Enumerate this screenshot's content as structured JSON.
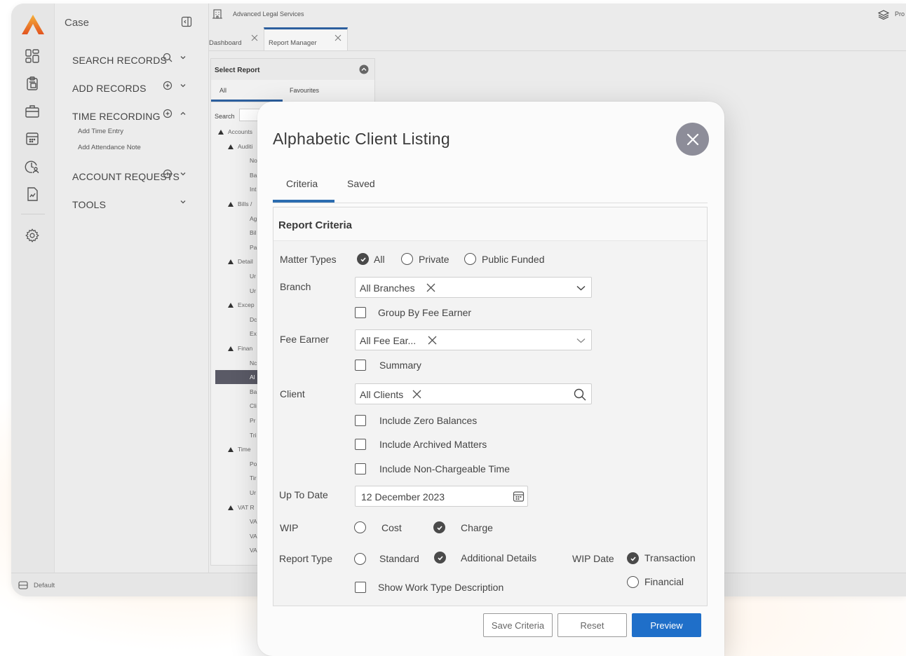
{
  "app": {
    "company": "Advanced Legal Services",
    "profile_label": "Pro",
    "status_label": "Default"
  },
  "sidebar": {
    "title": "Case",
    "items": [
      {
        "label": "SEARCH RECORDS",
        "icon": "search-icon"
      },
      {
        "label": "ADD RECORDS",
        "icon": "plus-circle-icon"
      },
      {
        "label": "TIME RECORDING",
        "icon": "plus-circle-icon"
      },
      {
        "label": "ACCOUNT REQUESTS",
        "icon": "plus-circle-icon"
      },
      {
        "label": "TOOLS",
        "icon": ""
      }
    ],
    "time_recording_sub": [
      "Add Time Entry",
      "Add Attendance Note"
    ]
  },
  "tabs": [
    {
      "label": "Dashboard",
      "active": false
    },
    {
      "label": "Report Manager",
      "active": true
    }
  ],
  "select_report": {
    "title": "Select Report",
    "tabs": [
      "All",
      "Favourites"
    ],
    "search_label": "Search",
    "tree": [
      {
        "label": "Accounts",
        "level": 0,
        "expanded": true
      },
      {
        "label": "Auditi",
        "level": 1,
        "expanded": true
      },
      {
        "label": "No",
        "level": 2
      },
      {
        "label": "Ba",
        "level": 2
      },
      {
        "label": "Int",
        "level": 2
      },
      {
        "label": "Bills /",
        "level": 1,
        "expanded": true
      },
      {
        "label": "Ag",
        "level": 2
      },
      {
        "label": "Bil",
        "level": 2
      },
      {
        "label": "Pa",
        "level": 2
      },
      {
        "label": "Detail",
        "level": 1,
        "expanded": true
      },
      {
        "label": "Ur",
        "level": 2
      },
      {
        "label": "Ur",
        "level": 2
      },
      {
        "label": "Excep",
        "level": 1,
        "expanded": true
      },
      {
        "label": "Dc",
        "level": 2
      },
      {
        "label": "Ex",
        "level": 2
      },
      {
        "label": "Finan",
        "level": 1,
        "expanded": true
      },
      {
        "label": "Nc",
        "level": 2
      },
      {
        "label": "Al",
        "level": 2,
        "selected": true
      },
      {
        "label": "Ba",
        "level": 2
      },
      {
        "label": "Cli",
        "level": 2
      },
      {
        "label": "Pr",
        "level": 2
      },
      {
        "label": "Tri",
        "level": 2
      },
      {
        "label": "Time",
        "level": 1,
        "expanded": true
      },
      {
        "label": "Po",
        "level": 2
      },
      {
        "label": "Tir",
        "level": 2
      },
      {
        "label": "Ur",
        "level": 2
      },
      {
        "label": "VAT R",
        "level": 1,
        "expanded": true
      },
      {
        "label": "VA",
        "level": 2
      },
      {
        "label": "VA",
        "level": 2
      },
      {
        "label": "VA",
        "level": 2
      }
    ]
  },
  "modal": {
    "title": "Alphabetic Client Listing",
    "tabs": [
      "Criteria",
      "Saved"
    ],
    "active_tab": "Criteria",
    "section_title": "Report Criteria",
    "matter_types": {
      "label": "Matter Types",
      "options": [
        "All",
        "Private",
        "Public Funded"
      ],
      "selected": "All"
    },
    "branch": {
      "label": "Branch",
      "value": "All Branches"
    },
    "group_by_fee_earner": {
      "label": "Group By Fee Earner",
      "checked": false
    },
    "fee_earner": {
      "label": "Fee Earner",
      "value": "All Fee Ear..."
    },
    "summary": {
      "label": "Summary",
      "checked": false
    },
    "client": {
      "label": "Client",
      "value": "All Clients"
    },
    "include_zero_balances": {
      "label": "Include Zero Balances",
      "checked": false
    },
    "include_archived_matters": {
      "label": "Include Archived Matters",
      "checked": false
    },
    "include_non_chargeable_time": {
      "label": "Include Non-Chargeable Time",
      "checked": false
    },
    "up_to_date": {
      "label": "Up To Date",
      "value": "12 December 2023"
    },
    "wip": {
      "label": "WIP",
      "options": [
        "Cost",
        "Charge"
      ],
      "selected": "Charge"
    },
    "report_type": {
      "label": "Report Type",
      "options": [
        "Standard",
        "Additional Details"
      ],
      "selected": "Additional Details"
    },
    "wip_date": {
      "label": "WIP Date",
      "options": [
        "Transaction",
        "Financial"
      ],
      "selected": "Transaction"
    },
    "show_work_type_description": {
      "label": "Show Work Type Description",
      "checked": false
    },
    "buttons": {
      "save": "Save Criteria",
      "reset": "Reset",
      "preview": "Preview"
    }
  },
  "colors": {
    "accent": "#1f6fc9",
    "tab_underline": "#2c6db0",
    "logo_top": "#f0a02a",
    "logo_bottom": "#e2531f",
    "close_button": "#8d8d99"
  }
}
